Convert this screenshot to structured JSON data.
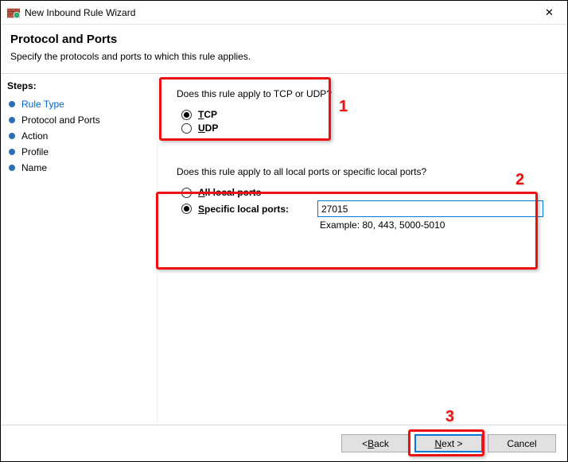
{
  "window": {
    "title": "New Inbound Rule Wizard",
    "close_glyph": "✕"
  },
  "header": {
    "title": "Protocol and Ports",
    "subtitle": "Specify the protocols and ports to which this rule applies."
  },
  "sidebar": {
    "label": "Steps:",
    "items": [
      {
        "label": "Rule Type",
        "state": "completed"
      },
      {
        "label": "Protocol and Ports",
        "state": "current"
      },
      {
        "label": "Action",
        "state": "pending"
      },
      {
        "label": "Profile",
        "state": "pending"
      },
      {
        "label": "Name",
        "state": "pending"
      }
    ]
  },
  "content": {
    "q1": "Does this rule apply to TCP or UDP?",
    "tcp_label_pre": "T",
    "tcp_label_post": "CP",
    "udp_label_pre": "U",
    "udp_label_post": "DP",
    "protocol_selected": "TCP",
    "q2": "Does this rule apply to all local ports or specific local ports?",
    "all_ports_pre": "A",
    "all_ports_post": "ll local ports",
    "specific_pre": "S",
    "specific_post": "pecific local ports:",
    "ports_selected": "specific",
    "port_value": "27015",
    "example": "Example: 80, 443, 5000-5010"
  },
  "annotations": {
    "n1": "1",
    "n2": "2",
    "n3": "3"
  },
  "footer": {
    "back_pre": "< ",
    "back_ul": "B",
    "back_post": "ack",
    "next_ul": "N",
    "next_post": "ext >",
    "cancel": "Cancel"
  }
}
